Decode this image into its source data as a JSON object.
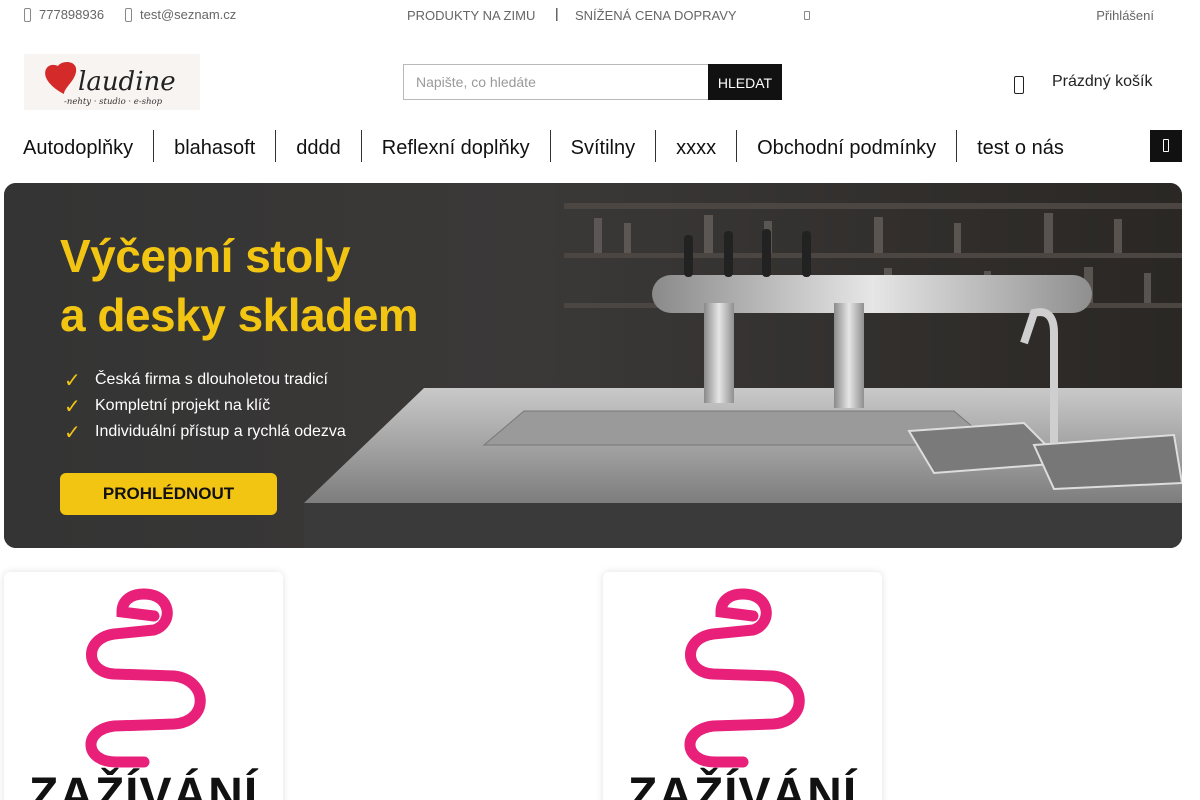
{
  "topbar": {
    "phone": "777898936",
    "email": "test@seznam.cz",
    "links": [
      "PRODUKTY NA ZIMU",
      "SNÍŽENÁ CENA DOPRAVY"
    ],
    "separator": "|",
    "login": "Přihlášení"
  },
  "logo": {
    "text": "laudine",
    "tagline": "-nehty · studio · e-shop",
    "heart_color": "#d42a2a"
  },
  "search": {
    "placeholder": "Napište, co hledáte",
    "button_label": "HLEDAT"
  },
  "cart": {
    "label": "Prázdný košík",
    "icon": "bag-icon"
  },
  "nav": {
    "items": [
      "Autodoplňky",
      "blahasoft",
      "dddd",
      "Reflexní doplňky",
      "Svítilny",
      "xxxx",
      "Obchodní podmínky",
      "test o nás"
    ],
    "menu_icon": "menu-icon"
  },
  "banner": {
    "title_line1": "Výčepní stoly",
    "title_line2": "a desky skladem",
    "bullets": [
      "Česká firma s dlouholetou tradicí",
      "Kompletní projekt na klíč",
      "Individuální přístup a rychlá odezva"
    ],
    "check_glyph": "✓",
    "cta": "PROHLÉDNOUT",
    "accent_color": "#f3c513"
  },
  "products": [
    {
      "label": "ZAŽÍVÁNÍ",
      "icon": "intestine-icon",
      "icon_color": "#e8207a"
    },
    {
      "label": "ZAŽÍVÁNÍ",
      "icon": "intestine-icon",
      "icon_color": "#e8207a"
    }
  ]
}
